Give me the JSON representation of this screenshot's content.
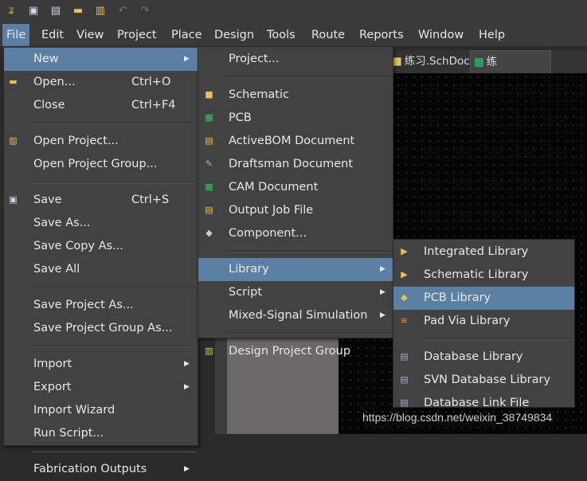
{
  "toolbar": {
    "icons": [
      "altium-logo-icon",
      "save-icon",
      "save-all-icon",
      "open-folder-icon",
      "open-project-icon",
      "undo-icon",
      "redo-icon"
    ]
  },
  "menubar": [
    "File",
    "Edit",
    "View",
    "Project",
    "Place",
    "Design",
    "Tools",
    "Route",
    "Reports",
    "Window",
    "Help"
  ],
  "tabs": [
    {
      "label": "练习.SchDoc",
      "icon": "schdoc-icon"
    },
    {
      "label": "练习.PcbDoc",
      "icon": "pcbdoc-icon",
      "active": true
    }
  ],
  "file_menu": [
    {
      "label": "New",
      "submenu": true,
      "hl": true
    },
    {
      "label": "Open...",
      "shortcut": "Ctrl+O",
      "icon": "open-folder-icon"
    },
    {
      "label": "Close",
      "shortcut": "Ctrl+F4"
    },
    {
      "sep": true
    },
    {
      "label": "Open Project...",
      "icon": "open-project-icon"
    },
    {
      "label": "Open Project Group..."
    },
    {
      "sep": true
    },
    {
      "label": "Save",
      "shortcut": "Ctrl+S",
      "icon": "save-icon"
    },
    {
      "label": "Save As..."
    },
    {
      "label": "Save Copy As..."
    },
    {
      "label": "Save All"
    },
    {
      "sep": true
    },
    {
      "label": "Save Project As..."
    },
    {
      "label": "Save Project Group As..."
    },
    {
      "sep": true
    },
    {
      "label": "Import",
      "submenu": true
    },
    {
      "label": "Export",
      "submenu": true
    },
    {
      "label": "Import Wizard"
    },
    {
      "label": "Run Script..."
    },
    {
      "sep": true
    },
    {
      "label": "Fabrication Outputs",
      "submenu": true
    }
  ],
  "new_menu": [
    {
      "label": "Project..."
    },
    {
      "sep": true
    },
    {
      "label": "Schematic",
      "icon": "schematic-icon"
    },
    {
      "label": "PCB",
      "icon": "pcb-icon"
    },
    {
      "label": "ActiveBOM Document",
      "icon": "activebom-icon"
    },
    {
      "label": "Draftsman Document",
      "icon": "draftsman-icon"
    },
    {
      "label": "CAM Document",
      "icon": "cam-icon"
    },
    {
      "label": "Output Job File",
      "icon": "output-job-icon"
    },
    {
      "label": "Component...",
      "icon": "component-icon"
    },
    {
      "sep": true
    },
    {
      "label": "Library",
      "submenu": true,
      "hl": true
    },
    {
      "label": "Script",
      "submenu": true
    },
    {
      "label": "Mixed-Signal Simulation",
      "submenu": true
    },
    {
      "sep": true
    },
    {
      "label": "Design Project Group",
      "icon": "project-group-icon"
    }
  ],
  "library_menu": [
    {
      "label": "Integrated Library",
      "icon": "integrated-library-icon"
    },
    {
      "label": "Schematic Library",
      "icon": "schematic-library-icon"
    },
    {
      "label": "PCB Library",
      "icon": "pcb-library-icon",
      "hl": true
    },
    {
      "label": "Pad Via Library",
      "icon": "pad-via-library-icon"
    },
    {
      "sep": true
    },
    {
      "label": "Database Library",
      "icon": "database-library-icon"
    },
    {
      "label": "SVN Database Library",
      "icon": "svn-database-library-icon"
    },
    {
      "label": "Database Link File",
      "icon": "database-link-icon"
    }
  ],
  "watermark": "https://blog.csdn.net/weixin_38749834",
  "colors": {
    "highlight": "#5b80a3",
    "menu_bg": "#424242"
  }
}
